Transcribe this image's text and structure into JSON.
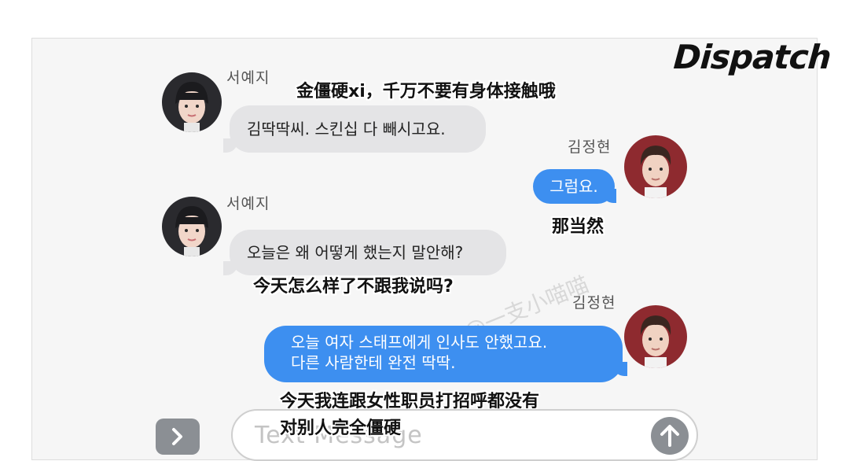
{
  "brand": {
    "logo_text": "Dispatch"
  },
  "watermark": "@一支小喵喵",
  "colors": {
    "blue_bubble": "#3d8ff0",
    "gray_bubble": "#e4e4e6",
    "panel_bg": "#f6f6f6"
  },
  "messages": [
    {
      "sender": "서예지",
      "side": "left",
      "text": "김딱딱씨. 스킨십 다 빼시고요.",
      "subtitle": "金僵硬xi，千万不要有身体接触哦"
    },
    {
      "sender": "김정현",
      "side": "right",
      "text": "그럼요.",
      "subtitle": "那当然"
    },
    {
      "sender": "서예지",
      "side": "left",
      "text": "오늘은 왜 어떻게 했는지 말안해?",
      "subtitle": "今天怎么样了不跟我说吗?"
    },
    {
      "sender": "김정현",
      "side": "right",
      "text_line1": "오늘 여자 스태프에게 인사도 안했고요.",
      "text_line2": "다른 사람한테 완전 딱딱.",
      "subtitle_line1": "今天我连跟女性职员打招呼都没有",
      "subtitle_line2": "对别人完全僵硬"
    }
  ],
  "composer": {
    "expand_icon": "chevron-right-icon",
    "placeholder": "Text Message",
    "send_icon": "arrow-up-icon"
  }
}
